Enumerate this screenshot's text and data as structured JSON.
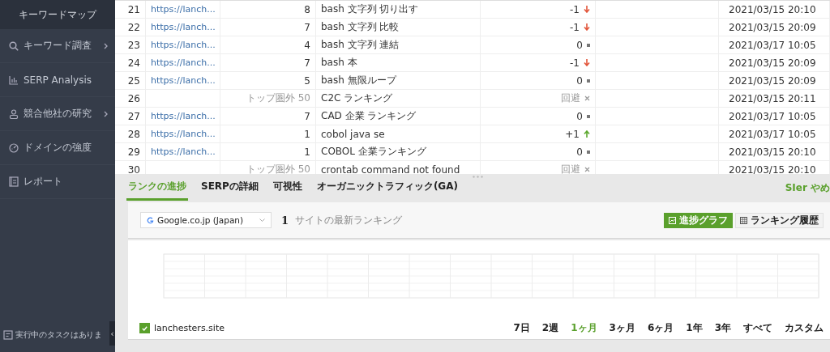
{
  "sidebar": {
    "title": "キーワードマップ",
    "items": [
      {
        "label": "キーワード調査",
        "kind": "search",
        "has_submenu": true
      },
      {
        "label": "SERP Analysis",
        "kind": "chart",
        "has_submenu": false
      },
      {
        "label": "競合他社の研究",
        "kind": "person",
        "has_submenu": true
      },
      {
        "label": "ドメインの強度",
        "kind": "gauge",
        "has_submenu": false
      },
      {
        "label": "レポート",
        "kind": "report",
        "has_submenu": false
      }
    ],
    "task_status": "実行中のタスクはありま",
    "collapse_handle": "‹"
  },
  "table": {
    "rows": [
      {
        "number": "21",
        "url": "https://lanch...",
        "rank": "8",
        "out_of_top": false,
        "keyword": "bash 文字列 切り出す",
        "change": "-1",
        "kind": "down",
        "date": "2021/03/15 20:10"
      },
      {
        "number": "22",
        "url": "https://lanch...",
        "rank": "7",
        "out_of_top": false,
        "keyword": "bash 文字列 比較",
        "change": "-1",
        "kind": "down",
        "date": "2021/03/15 20:09"
      },
      {
        "number": "23",
        "url": "https://lanch...",
        "rank": "4",
        "out_of_top": false,
        "keyword": "bash 文字列 連結",
        "change": "0",
        "kind": "same",
        "date": "2021/03/17 10:05"
      },
      {
        "number": "24",
        "url": "https://lanch...",
        "rank": "7",
        "out_of_top": false,
        "keyword": "bash 本",
        "change": "-1",
        "kind": "down",
        "date": "2021/03/15 20:09"
      },
      {
        "number": "25",
        "url": "https://lanch...",
        "rank": "5",
        "out_of_top": false,
        "keyword": "bash 無限ループ",
        "change": "0",
        "kind": "same",
        "date": "2021/03/15 20:09"
      },
      {
        "number": "26",
        "rank": "トップ圏外 50",
        "out_of_top": true,
        "keyword": "C2C ランキング",
        "change": "回避",
        "kind": "avoided",
        "date": "2021/03/15 20:11"
      },
      {
        "number": "27",
        "url": "https://lanch...",
        "rank": "7",
        "out_of_top": false,
        "keyword": "CAD 企業 ランキング",
        "change": "0",
        "kind": "same",
        "date": "2021/03/17 10:05"
      },
      {
        "number": "28",
        "url": "https://lanch...",
        "rank": "1",
        "out_of_top": false,
        "keyword": "cobol java se",
        "change": "+1",
        "kind": "up",
        "date": "2021/03/17 10:05"
      },
      {
        "number": "29",
        "url": "https://lanch...",
        "rank": "1",
        "out_of_top": false,
        "keyword": "COBOL 企業ランキング",
        "change": "0",
        "kind": "same",
        "date": "2021/03/15 20:10"
      },
      {
        "number": "30",
        "rank": "トップ圏外 50",
        "out_of_top": true,
        "keyword": "crontab command not found",
        "change": "回避",
        "kind": "avoided",
        "date": "2021/03/15 20:10"
      }
    ]
  },
  "panel": {
    "tabs": [
      {
        "label": "ランクの進捗",
        "selected": true
      },
      {
        "label": "SERPの詳細",
        "selected": false
      },
      {
        "label": "可視性",
        "selected": false
      },
      {
        "label": "オーガニックトラフィック(GA)",
        "selected": false
      }
    ],
    "keyword_title": "SIer やめ",
    "search_engine": "Google.co.jp (Japan)",
    "site_count": "1",
    "site_count_label": "サイトの最新ランキング",
    "views": [
      {
        "label": "進捗グラフ",
        "kind": "graph",
        "selected": true
      },
      {
        "label": "ランキング履歴",
        "kind": "grid",
        "selected": false
      }
    ],
    "legend": {
      "label": "lanchesters.site",
      "checked": true
    },
    "timeframes": [
      {
        "label": "7日",
        "selected": false
      },
      {
        "label": "2週",
        "selected": false
      },
      {
        "label": "1ヶ月",
        "selected": true
      },
      {
        "label": "3ヶ月",
        "selected": false
      },
      {
        "label": "6ヶ月",
        "selected": false
      },
      {
        "label": "1年",
        "selected": false
      },
      {
        "label": "3年",
        "selected": false
      },
      {
        "label": "すべて",
        "selected": false
      },
      {
        "label": "カスタム",
        "selected": false
      }
    ]
  }
}
